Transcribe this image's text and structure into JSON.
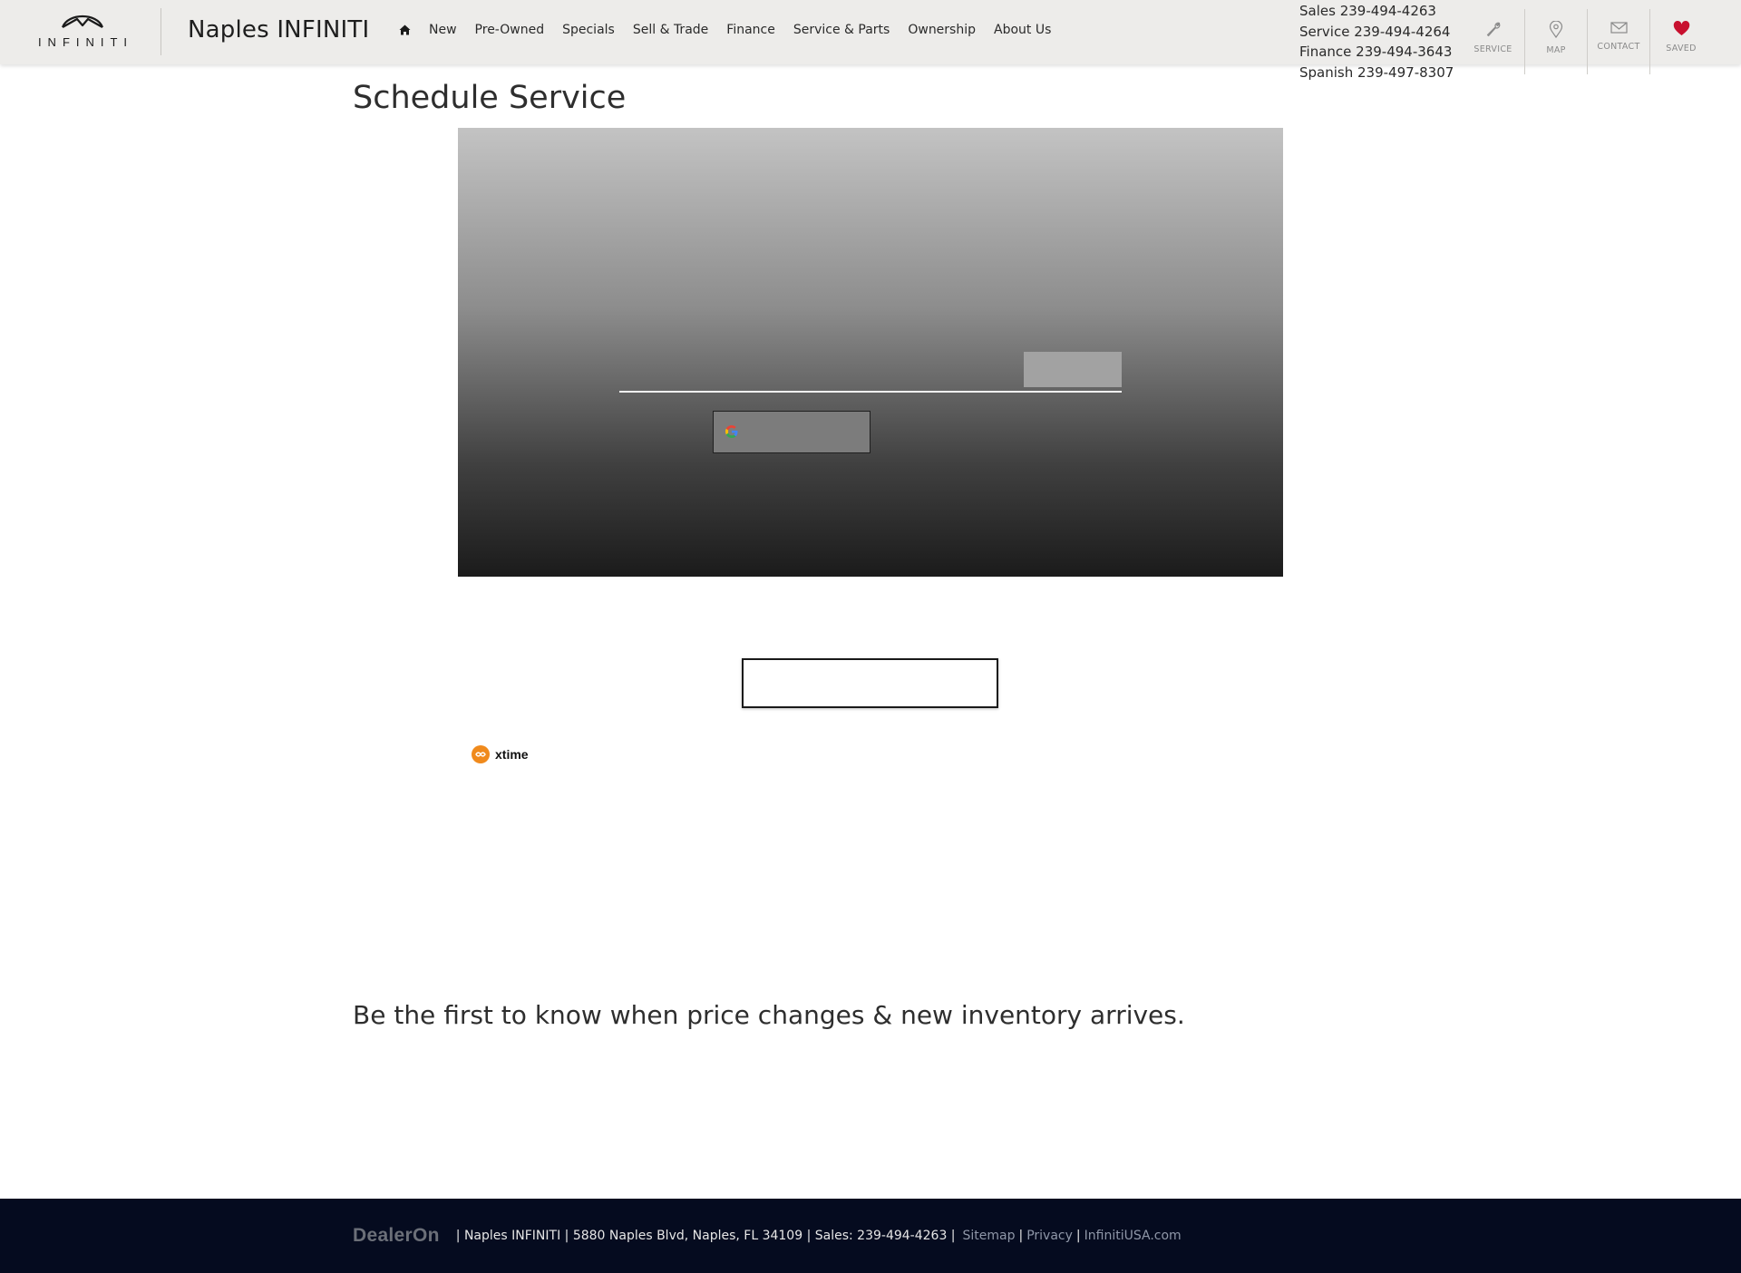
{
  "brand": {
    "logo_text": "INFINITI",
    "dealer_name": "Naples INFINITI"
  },
  "nav": {
    "home_icon": "home-icon",
    "items": [
      {
        "label": "New"
      },
      {
        "label": "Pre-Owned"
      },
      {
        "label": "Specials"
      },
      {
        "label": "Sell & Trade"
      },
      {
        "label": "Finance"
      },
      {
        "label": "Service & Parts"
      },
      {
        "label": "Ownership"
      },
      {
        "label": "About Us"
      }
    ]
  },
  "phones": {
    "sales": {
      "label": "Sales",
      "number": "239-494-4263"
    },
    "service": {
      "label": "Service",
      "number": "239-494-4264"
    },
    "finance": {
      "label": "Finance",
      "number": "239-494-3643"
    },
    "spanish": {
      "label": "Spanish",
      "number": "239-497-8307"
    }
  },
  "quick_links": {
    "service": {
      "label": "SERVICE",
      "icon": "wrench-icon"
    },
    "map": {
      "label": "MAP",
      "icon": "map-pin-icon"
    },
    "contact": {
      "label": "CONTACT",
      "icon": "envelope-icon"
    },
    "saved": {
      "label": "SAVED",
      "icon": "heart-icon",
      "color": "#c8102e"
    }
  },
  "main": {
    "title": "Schedule Service",
    "xtime_label": "xtime",
    "xtime_color": "#f08a1c",
    "promo_text": "Be the first to know when price changes & new inventory arrives."
  },
  "footer": {
    "provider": "DealerOn",
    "info": "| Naples INFINITI | 5880 Naples Blvd, Naples, FL 34109 | Sales: 239-494-4263 |",
    "links": {
      "sitemap": "Sitemap",
      "privacy": "Privacy",
      "infiniti": "InfinitiUSA.com"
    },
    "divider": "|",
    "background": "#050b1f"
  }
}
